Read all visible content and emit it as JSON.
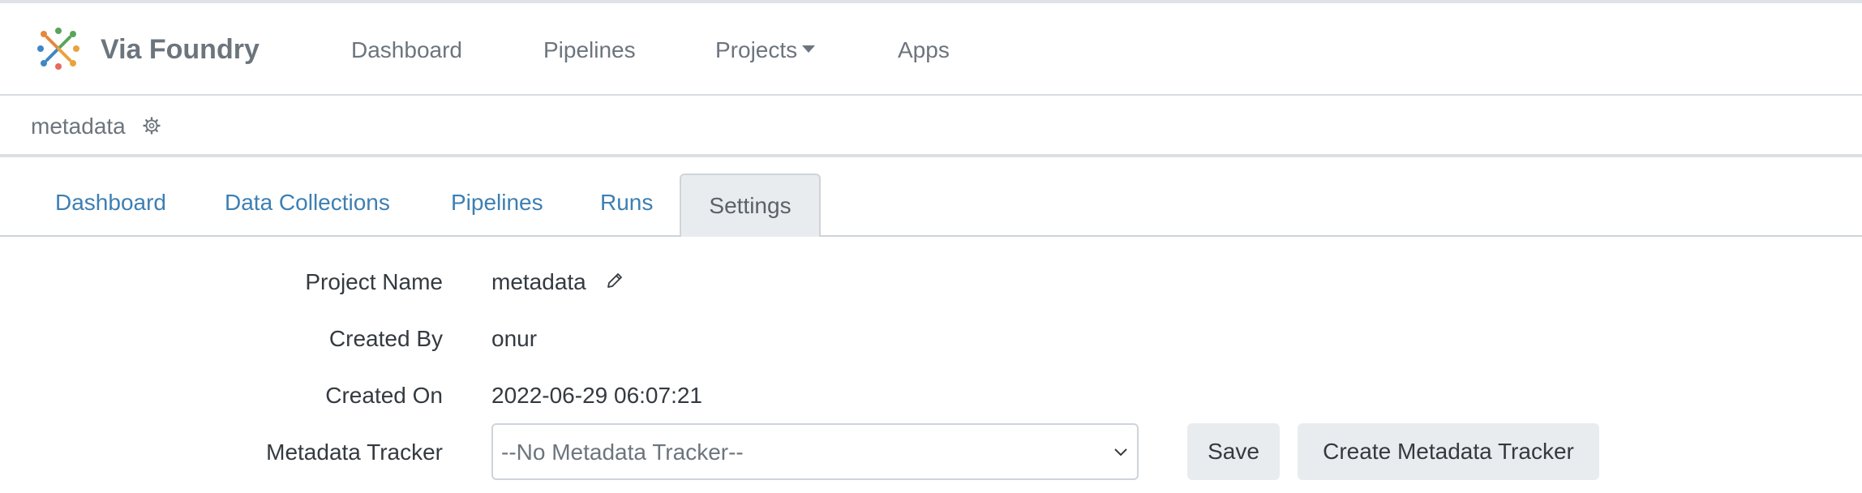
{
  "app": {
    "brand": "Via Foundry",
    "logo_icon": "via-foundry-logo"
  },
  "nav": {
    "items": [
      {
        "label": "Dashboard"
      },
      {
        "label": "Pipelines"
      },
      {
        "label": "Projects",
        "has_dropdown": true
      },
      {
        "label": "Apps"
      }
    ]
  },
  "project": {
    "title": "metadata",
    "settings_icon": "gear-icon"
  },
  "tabs": [
    {
      "label": "Dashboard"
    },
    {
      "label": "Data Collections"
    },
    {
      "label": "Pipelines"
    },
    {
      "label": "Runs"
    },
    {
      "label": "Settings",
      "active": true
    }
  ],
  "settings": {
    "project_name_label": "Project Name",
    "project_name_value": "metadata",
    "edit_icon": "pencil-icon",
    "created_by_label": "Created By",
    "created_by_value": "onur",
    "created_on_label": "Created On",
    "created_on_value": "2022-06-29 06:07:21",
    "metadata_tracker_label": "Metadata Tracker",
    "metadata_tracker_selected": "--No Metadata Tracker--",
    "save_label": "Save",
    "create_tracker_label": "Create Metadata Tracker"
  },
  "colors": {
    "link": "#3d7fb3",
    "muted": "#6c757d",
    "tab_active_bg": "#e9ecef"
  }
}
